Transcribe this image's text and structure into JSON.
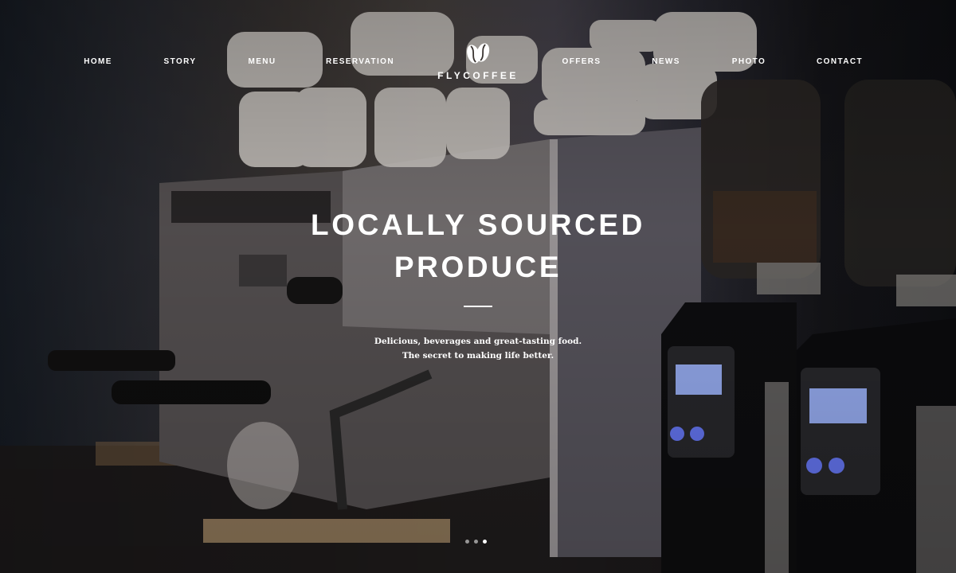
{
  "nav": {
    "items": [
      {
        "label": "HOME"
      },
      {
        "label": "STORY"
      },
      {
        "label": "MENU"
      },
      {
        "label": "RESERVATION"
      },
      {
        "label": "OFFERS"
      },
      {
        "label": "NEWS"
      },
      {
        "label": "PHOTO"
      },
      {
        "label": "CONTACT"
      }
    ]
  },
  "brand": {
    "name": "FLYCOFFEE",
    "icon": "coffee-beans-icon"
  },
  "hero": {
    "headline_line1": "LOCALLY SOURCED",
    "headline_line2": "PRODUCE",
    "tagline_line1": "Delicious, beverages and great-tasting food.",
    "tagline_line2": "The secret to making life better."
  },
  "slider": {
    "slide_count": 3,
    "active_index": 2
  },
  "colors": {
    "text": "#ffffff",
    "background": "#15181d"
  }
}
